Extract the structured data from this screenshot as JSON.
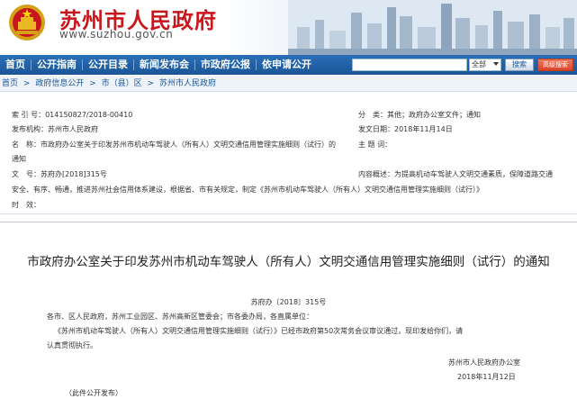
{
  "header": {
    "title": "苏州市人民政府",
    "url": "www.suzhou.gov.cn"
  },
  "nav": {
    "items": [
      "首页",
      "公开指南",
      "公开目录",
      "新闻发布会",
      "市政府公报",
      "依申请公开"
    ],
    "search_select": "全部",
    "search_button": "搜索",
    "advanced_button": "高级搜索"
  },
  "breadcrumb": [
    "首页",
    ">",
    "政府信息公开",
    ">",
    "市（县）区",
    ">",
    "苏州市人民政府"
  ],
  "info": {
    "index_no_label": "索 引 号：",
    "index_no": "014150827/2018-00410",
    "category_label": "分　类：",
    "category": "其他；政府办公室文件；通知",
    "issuer_label": "发布机构：",
    "issuer": "苏州市人民政府",
    "date_label": "发文日期：",
    "date": "2018年11月14日",
    "name_label": "名　称：",
    "name_line1": "市政府办公室关于印发苏州市机动车驾驶人（所有人）文明交通信用管理实施细则（试行）的",
    "name_line2": "通知",
    "keywords_label": "主 题 词：",
    "doc_no_label": "文　号：",
    "doc_no": "苏府办[2018]315号",
    "summary_label": "内容概述：",
    "summary_line1": "为提高机动车驾驶人文明交通素质，保障道路交通",
    "summary_line2": "安全、有序、畅通，推进苏州社会信用体系建设，根据省、市有关规定，制定《苏州市机动车驾驶人（所有人）文明交通信用管理实施细则（试行）》",
    "validity_label": "时　效："
  },
  "article": {
    "title": "市政府办公室关于印发苏州市机动车驾驶人（所有人）文明交通信用管理实施细则（试行）的通知",
    "doc_no": "苏府办〔2018〕315号",
    "recipients": "各市、区人民政府，苏州工业园区、苏州高新区管委会；市各委办局，各直属单位：",
    "body_line1": "《苏州市机动车驾驶人（所有人）文明交通信用管理实施细则（试行）》已经市政府第50次常务会议审议通过，现印发给你们，请",
    "body_line2": "认真贯彻执行。",
    "signer": "苏州市人民政府办公室",
    "sign_date": "2018年11月12日",
    "public_note": "（此件公开发布）"
  },
  "colors": {
    "title_red": "#c8161d",
    "nav_blue": "#1b5597",
    "link_blue": "#1b5597"
  }
}
